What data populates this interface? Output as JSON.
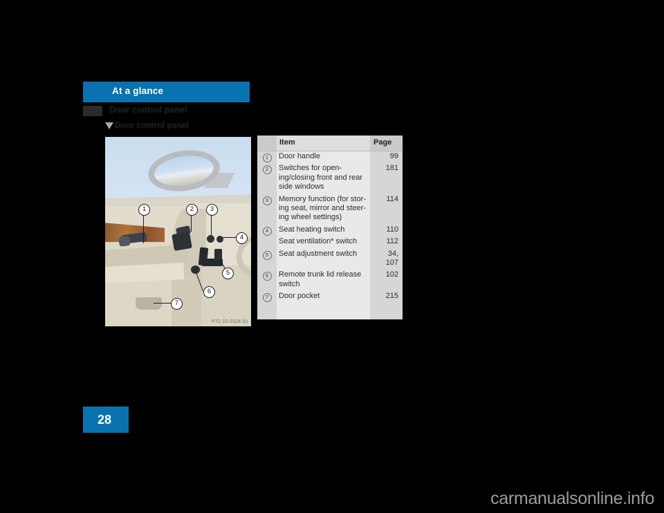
{
  "document": {
    "section_header": "At a glance",
    "chapter_title": "Door control panel",
    "subheading": "Door control panel",
    "page_number": "28",
    "watermark": "carmanualsonline.info"
  },
  "figure": {
    "caption": "P72.10-2324-31",
    "callouts": [
      "1",
      "2",
      "3",
      "4",
      "5",
      "6",
      "7"
    ]
  },
  "table": {
    "headers": {
      "num": "",
      "item": "Item",
      "page": "Page"
    },
    "rows": [
      {
        "num": "1",
        "item": "Door handle",
        "page": "99"
      },
      {
        "num": "2",
        "item": "Switches for open-\ning/closing front and rear\nside windows",
        "page": "181"
      },
      {
        "num": "3",
        "item": "Memory function (for stor-\ning seat, mirror and steer-\ning wheel settings)",
        "page": "114"
      },
      {
        "num": "4",
        "item": "Seat heating switch",
        "page": "110"
      },
      {
        "num": "",
        "item": "Seat ventilation* switch",
        "page": "112"
      },
      {
        "num": "5",
        "item": "Seat adjustment switch",
        "page": "34,\n107"
      },
      {
        "num": "6",
        "item": "Remote trunk lid release\nswitch",
        "page": "102"
      },
      {
        "num": "7",
        "item": "Door pocket",
        "page": "215"
      }
    ]
  },
  "colors": {
    "accent_blue": "#0a72ae",
    "table_bg": "#e9e9e9",
    "table_alt_bg": "#d6d6d6",
    "header_bg": "#cacaca"
  }
}
